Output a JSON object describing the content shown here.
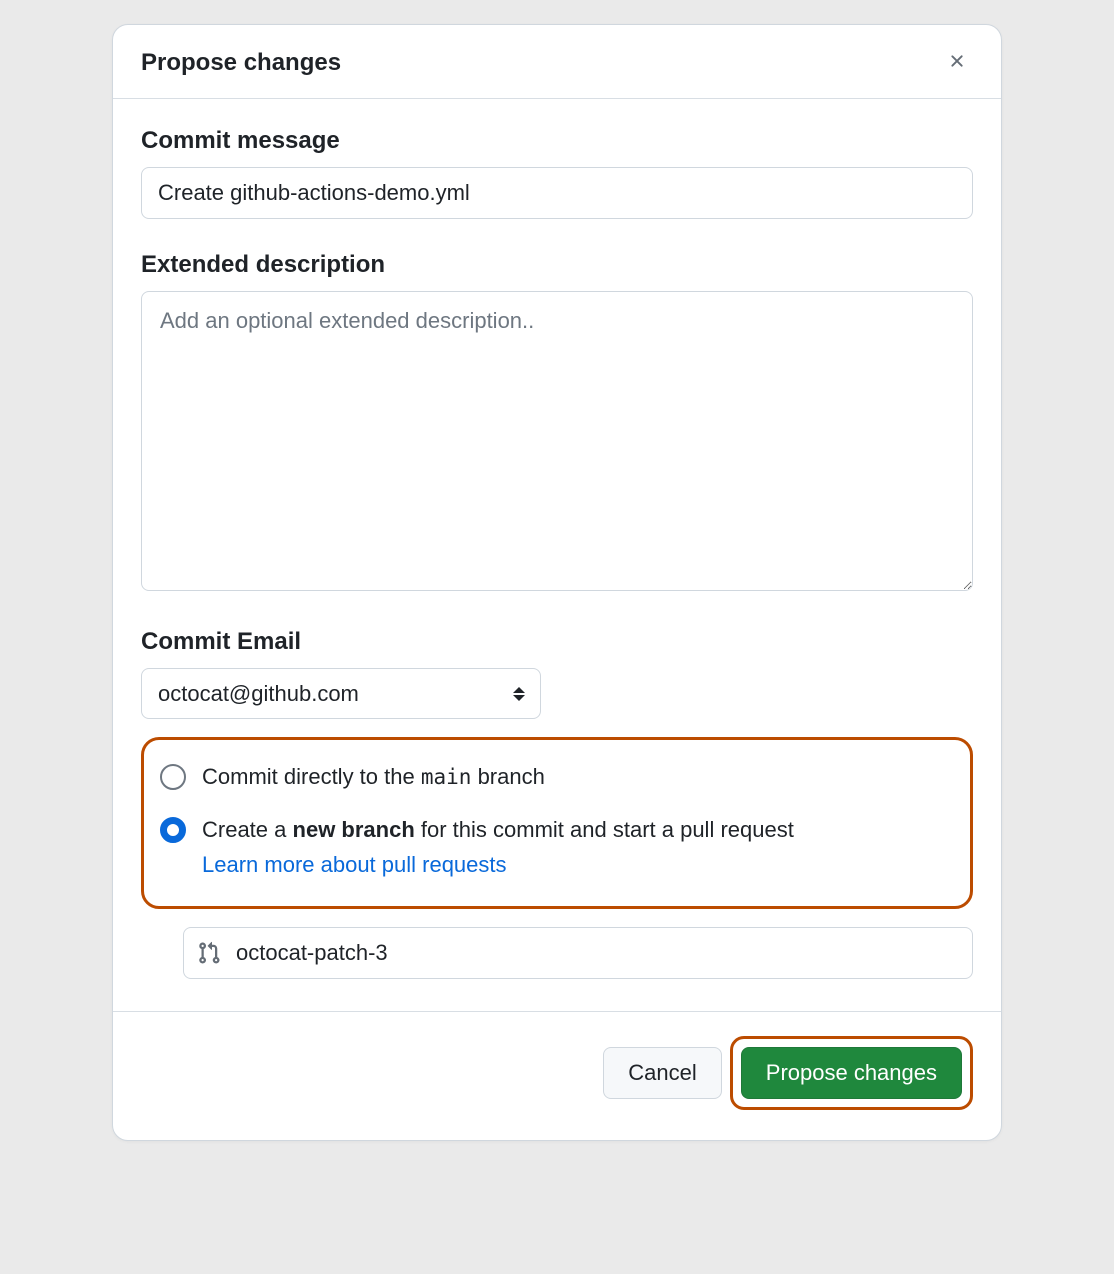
{
  "dialog": {
    "title": "Propose changes"
  },
  "commitMessage": {
    "label": "Commit message",
    "value": "Create github-actions-demo.yml"
  },
  "extendedDescription": {
    "label": "Extended description",
    "placeholder": "Add an optional extended description.."
  },
  "commitEmail": {
    "label": "Commit Email",
    "selected": "octocat@github.com"
  },
  "branchChoice": {
    "direct": {
      "prefix": "Commit directly to the",
      "branch": "main",
      "suffix": "branch"
    },
    "newBranch": {
      "prefix": "Create a",
      "bold": "new branch",
      "suffix": "for this commit and start a pull request",
      "learnMore": "Learn more about pull requests"
    },
    "branchName": "octocat-patch-3"
  },
  "footer": {
    "cancel": "Cancel",
    "submit": "Propose changes"
  }
}
